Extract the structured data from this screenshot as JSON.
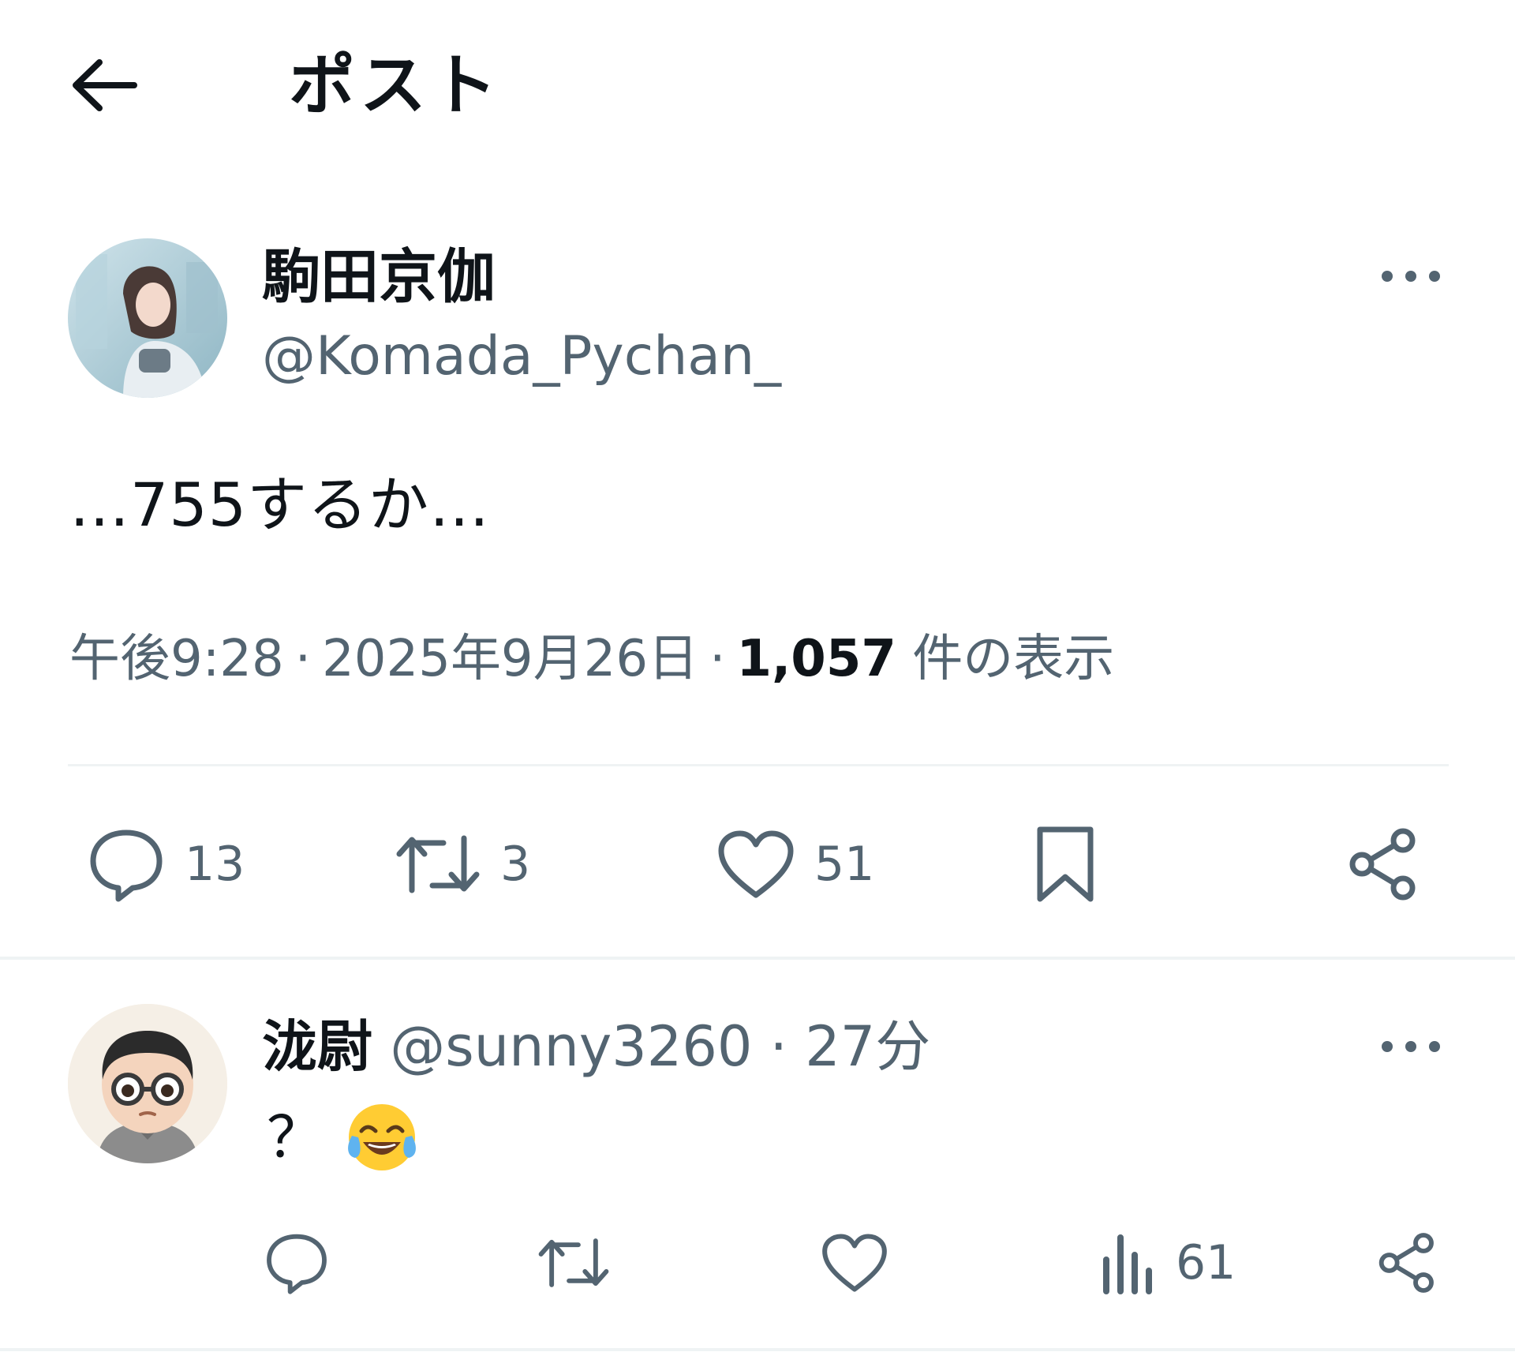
{
  "header": {
    "title": "ポスト",
    "back_icon": "arrow-left-icon"
  },
  "post": {
    "display_name": "駒田京伽",
    "handle": "@Komada_Pychan_",
    "text": "…755するか…",
    "time": "午後9:28",
    "date": "2025年9月26日",
    "views_count": "1,057",
    "views_label": "件の表示",
    "separator": "·",
    "actions": {
      "reply_count": "13",
      "retweet_count": "3",
      "like_count": "51"
    }
  },
  "reply": {
    "display_name": "泷尉",
    "handle": "@sunny3260",
    "separator": "·",
    "time": "27分",
    "text": "？",
    "emoji": "face-with-tears-of-joy",
    "actions": {
      "views_count": "61"
    }
  },
  "colors": {
    "text_primary": "#0f1419",
    "text_secondary": "#536471",
    "divider": "#eff3f4",
    "icon": "#536471"
  }
}
